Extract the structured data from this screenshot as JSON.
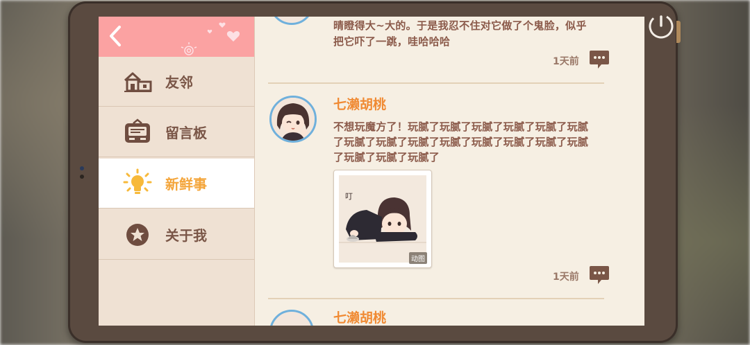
{
  "sidebar": {
    "items": [
      {
        "label": "友邻",
        "icon": "house-icon",
        "active": false
      },
      {
        "label": "留言板",
        "icon": "message-board-icon",
        "active": false
      },
      {
        "label": "新鲜事",
        "icon": "lightbulb-icon",
        "active": true
      },
      {
        "label": "关于我",
        "icon": "star-badge-icon",
        "active": false
      }
    ]
  },
  "feed": {
    "posts": [
      {
        "username": "",
        "text_lines": [
          "晴瞪得大~大的。于是我忍不住对它做了个鬼脸，似乎",
          "把它吓了一跳，哇哈哈哈"
        ],
        "time": "1天前"
      },
      {
        "username": "七濑胡桃",
        "text_lines": [
          "不想玩魔方了！玩腻了玩腻了玩腻了玩腻了玩腻了玩腻",
          "了玩腻了玩腻了玩腻了玩腻了玩腻了玩腻了玩腻了玩腻",
          "了玩腻了玩腻了玩腻了"
        ],
        "image_badge": "动图",
        "image_caption": "叮",
        "time": "1天前"
      },
      {
        "username": "七濑胡桃"
      }
    ]
  },
  "colors": {
    "header_pink": "#fba2a2",
    "active_label": "#f4a53a",
    "username": "#f08a33",
    "post_text": "#8b5a4a"
  }
}
